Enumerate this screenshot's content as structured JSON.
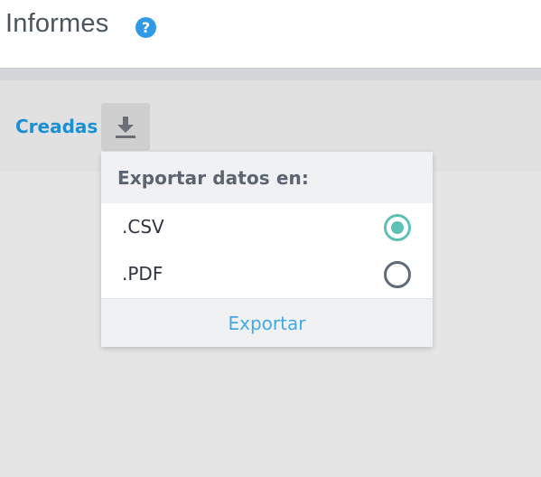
{
  "header": {
    "title": "Informes",
    "help_icon": "?"
  },
  "toolbar": {
    "active_tab": "Creadas",
    "download_icon": "download-icon"
  },
  "export_menu": {
    "title": "Exportar datos en:",
    "options": [
      {
        "label": ".CSV",
        "selected": true
      },
      {
        "label": ".PDF",
        "selected": false
      }
    ],
    "export_button": "Exportar"
  },
  "colors": {
    "accent_blue": "#1b8fd6",
    "radio_selected": "#5cc2b6",
    "export_text": "#43a8e8"
  }
}
